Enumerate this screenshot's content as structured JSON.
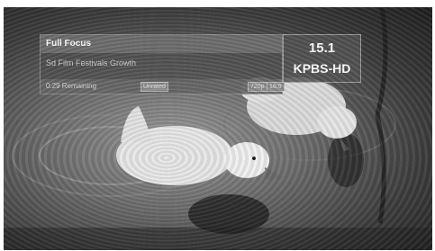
{
  "program": {
    "title": "Full Focus",
    "episode": "Sd Film Festivals Growth",
    "remaining": "0:29 Remaining",
    "rating": "Unrated",
    "resolution": "720p",
    "aspect": "16:9"
  },
  "channel": {
    "number": "15.1",
    "name": "KPBS-HD"
  }
}
